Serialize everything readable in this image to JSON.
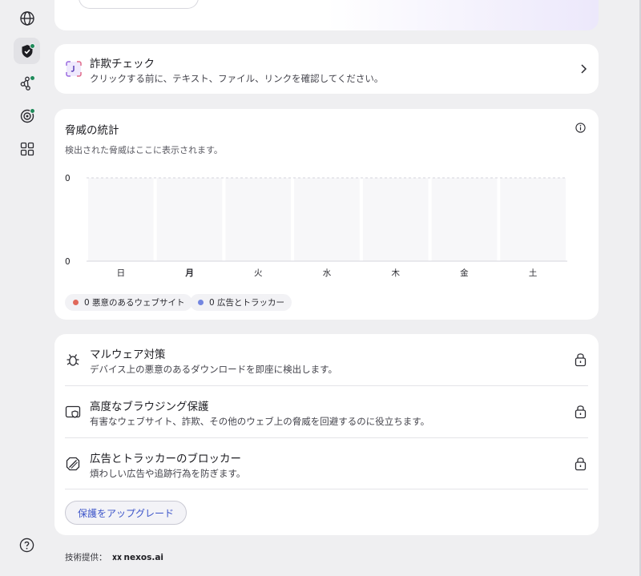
{
  "sidebar": {
    "items": [
      {
        "icon": "globe-icon",
        "name": "sidebar-item-browser"
      },
      {
        "icon": "shield-check-icon",
        "name": "sidebar-item-protection",
        "active": true,
        "badge": true
      },
      {
        "icon": "nodes-icon",
        "name": "sidebar-item-network",
        "badge": true
      },
      {
        "icon": "target-eye-icon",
        "name": "sidebar-item-privacy",
        "badge": true
      },
      {
        "icon": "apps-grid-icon",
        "name": "sidebar-item-apps"
      }
    ],
    "help_icon": "help-circle-icon"
  },
  "scam_check": {
    "title": "詐欺チェック",
    "subtitle": "クリックする前に、テキスト、ファイル、リンクを確認してください。"
  },
  "threat_stats": {
    "title": "脅威の統計",
    "subtitle": "検出された脅威はここに表示されます。",
    "legend": [
      {
        "label": "0 悪意のあるウェブサイト",
        "color": "#e0685a"
      },
      {
        "label": "0 広告とトラッカー",
        "color": "#7386e0"
      }
    ]
  },
  "chart_data": {
    "type": "bar",
    "categories": [
      "日",
      "月",
      "火",
      "水",
      "木",
      "金",
      "土"
    ],
    "series": [
      {
        "name": "悪意のあるウェブサイト",
        "values": [
          0,
          0,
          0,
          0,
          0,
          0,
          0
        ]
      },
      {
        "name": "広告とトラッカー",
        "values": [
          0,
          0,
          0,
          0,
          0,
          0,
          0
        ]
      }
    ],
    "y_ticks": [
      "0",
      "0"
    ],
    "highlighted_category": "月",
    "grid": true
  },
  "features": [
    {
      "icon": "bug-icon",
      "title": "マルウェア対策",
      "subtitle": "デバイス上の悪意のあるダウンロードを即座に検出します。",
      "locked": true
    },
    {
      "icon": "browser-shield-icon",
      "title": "高度なブラウジング保護",
      "subtitle": "有害なウェブサイト、詐欺、その他のウェブ上の脅威を回避するのに役立ちます。",
      "locked": true
    },
    {
      "icon": "ad-block-icon",
      "title": "広告とトラッカーのブロッカー",
      "subtitle": "煩わしい広告や追跡行為を防ぎます。",
      "locked": true
    }
  ],
  "upgrade_button": "保護をアップグレード",
  "footer": {
    "label": "技術提供：",
    "brand": "nexos.ai"
  }
}
